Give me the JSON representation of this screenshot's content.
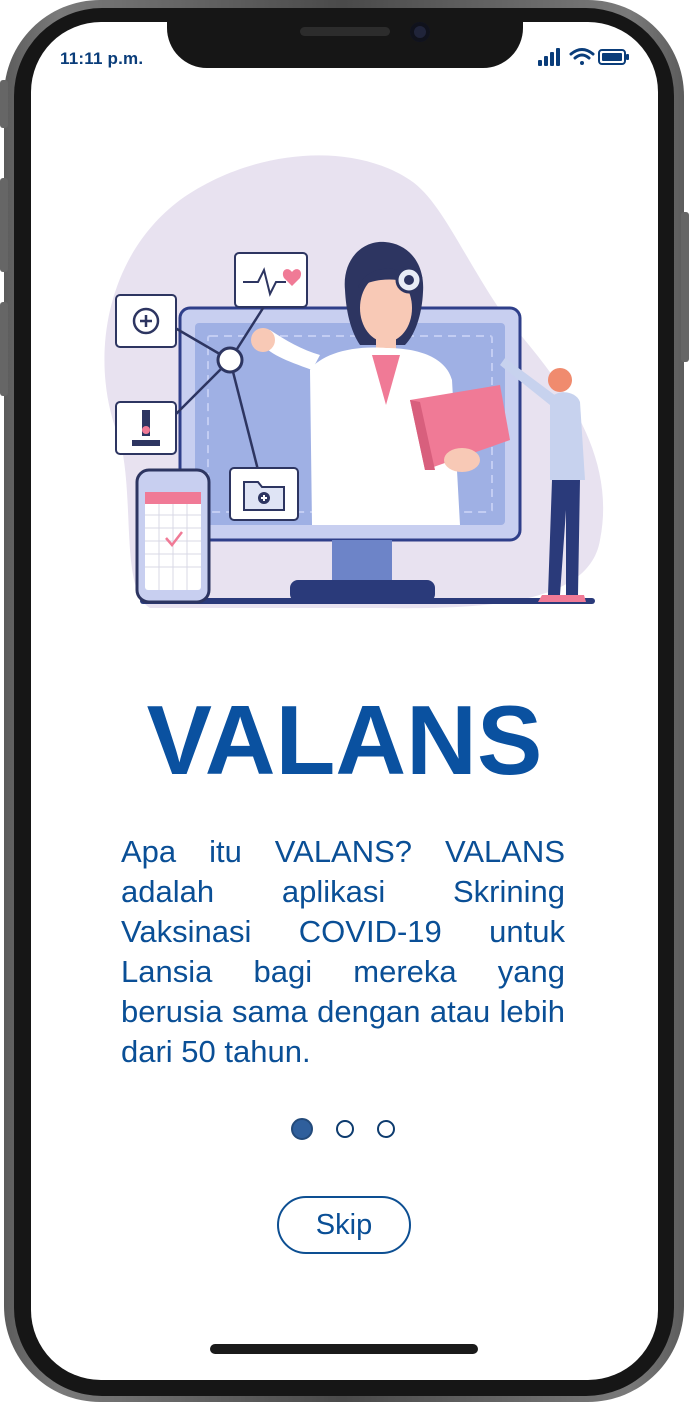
{
  "status_bar": {
    "time": "11:11 p.m."
  },
  "app": {
    "title": "VALANS",
    "description": "Apa itu VALANS? VALANS adalah aplikasi Skrining Vaksinasi COVID-19 untuk Lansia bagi mereka yang berusia sama dengan atau lebih dari 50 tahun."
  },
  "pager": {
    "pages": 3,
    "active_index": 0
  },
  "skip_button": {
    "label": "Skip"
  },
  "colors": {
    "primary": "#0a51a0",
    "text": "#0a4f96",
    "illustration_blob": "#e8e2f0",
    "illustration_accent": "#f07a96"
  }
}
